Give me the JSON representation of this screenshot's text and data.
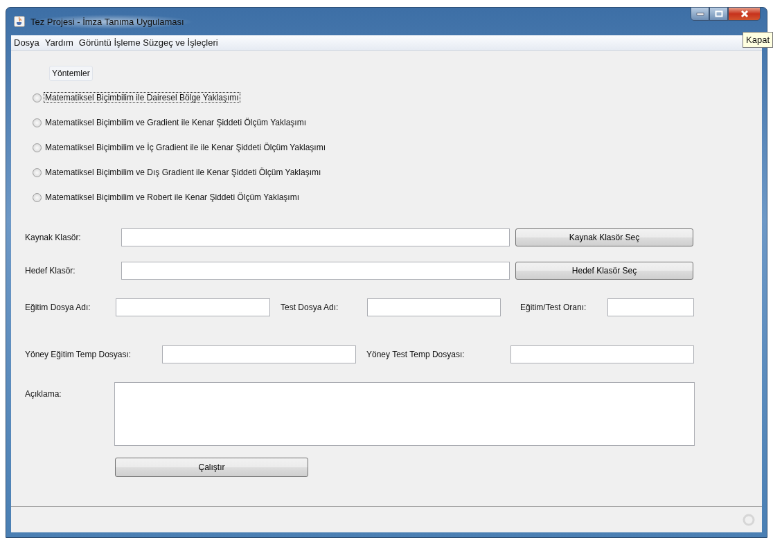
{
  "window": {
    "title": "Tez Projesi - İmza Tanıma Uygulaması",
    "tooltip": "Kapat"
  },
  "menu": [
    "Dosya",
    "Yardım",
    "Görüntü İşleme Süzgeç ve İşleçleri"
  ],
  "methods_title": "Yöntemler",
  "methods": [
    {
      "label": "Matematiksel Biçimbilim ile Dairesel Bölge Yaklaşımı",
      "selected": false,
      "focused": true
    },
    {
      "label": "Matematiksel Biçimbilim ve Gradient ile Kenar Şiddeti Ölçüm Yaklaşımı",
      "selected": false,
      "focused": false
    },
    {
      "label": "Matematiksel Biçimbilim ve İç Gradient ile ile Kenar Şiddeti Ölçüm Yaklaşımı",
      "selected": false,
      "focused": false
    },
    {
      "label": "Matematiksel Biçimbilim ve Dış Gradient ile Kenar Şiddeti Ölçüm Yaklaşımı",
      "selected": false,
      "focused": false
    },
    {
      "label": "Matematiksel Biçimbilim ve Robert ile Kenar Şiddeti Ölçüm Yaklaşımı",
      "selected": false,
      "focused": false
    }
  ],
  "source": {
    "label": "Kaynak Klasör:",
    "button": "Kaynak Klasör Seç"
  },
  "target": {
    "label": "Hedef Klasör:",
    "button": "Hedef Klasör Seç"
  },
  "files": [
    {
      "label": "Eğitim Dosya Adı:"
    },
    {
      "label": "Test Dosya Adı:"
    },
    {
      "label": "Eğitim/Test Oranı:"
    }
  ],
  "temps": [
    {
      "label": "Yöney Eğitim Temp Dosyası:"
    },
    {
      "label": "Yöney Test Temp Dosyası:"
    }
  ],
  "description": {
    "label": "Açıklama:"
  },
  "run_button": "Çalıştır"
}
